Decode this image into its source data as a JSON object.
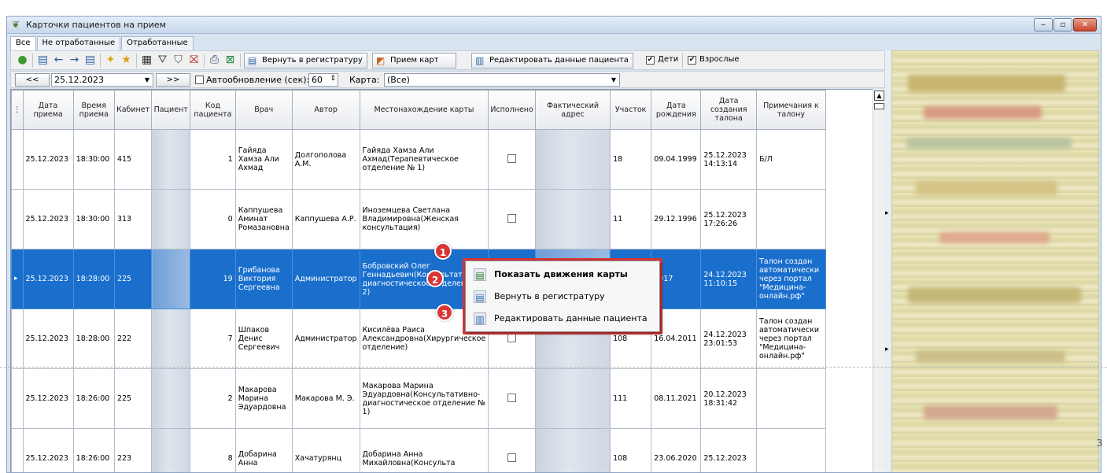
{
  "window": {
    "title": "Карточки пациентов на прием",
    "controls": {
      "minimize": "‒",
      "restore": "▫",
      "close": "✕"
    }
  },
  "tabs": [
    {
      "label": "Все",
      "active": true
    },
    {
      "label": "Не отработанные",
      "active": false
    },
    {
      "label": "Отработанные",
      "active": false
    }
  ],
  "toolbar": {
    "return_to_registry": "Вернуть в регистратуру",
    "receive_cards": "Прием карт",
    "edit_patient": "Редактировать данные пациента",
    "children_label": "Дети",
    "children_checked": true,
    "adults_label": "Взрослые",
    "adults_checked": true
  },
  "filter": {
    "prev": "<<",
    "date": "25.12.2023",
    "next": ">>",
    "autorefresh_label": "Автообновление (сек):",
    "autorefresh_value": "60",
    "card_label": "Карта:",
    "card_value": "(Все)"
  },
  "grid": {
    "columns": [
      "Дата приема",
      "Время приема",
      "Кабинет",
      "Пациент",
      "Код пациента",
      "Врач",
      "Автор",
      "Местонахождение карты",
      "Исполнено",
      "Фактический адрес",
      "Участок",
      "Дата рождения",
      "Дата создания талона",
      "Примечания к талону"
    ],
    "rows": [
      {
        "date": "25.12.2023",
        "time": "18:30:00",
        "cabinet": "415",
        "code_tail": "1",
        "doctor": "Гайяда Хамза Али Ахмад",
        "author": "Долгополова А.М.",
        "location": "Гайяда Хамза Али Ахмад(Терапевтическое отделение № 1)",
        "district": "18",
        "birth": "09.04.1999",
        "created": "25.12.2023 14:13:14",
        "note": "Б/Л"
      },
      {
        "date": "25.12.2023",
        "time": "18:30:00",
        "cabinet": "313",
        "code_tail": "0",
        "doctor": "Каппушева Аминат Ромазановна",
        "author": "Каппушева А.Р.",
        "location": "Иноземцева Светлана Владимировна(Женская консультация)",
        "district": "11",
        "birth": "29.12.1996",
        "created": "25.12.2023 17:26:26",
        "note": ""
      },
      {
        "date": "25.12.2023",
        "time": "18:28:00",
        "cabinet": "225",
        "code_tail": "19",
        "doctor": "Грибанова Виктория Сергеевна",
        "author": "Администратор",
        "location": "Бобровский Олег Геннадьевич(Консультативно-диагностическое отделение № 2)",
        "district": "",
        "birth": "2017",
        "created": "24.12.2023 11:10:15",
        "note": "Талон создан автоматически через портал \"Медицина-онлайн.рф\""
      },
      {
        "date": "25.12.2023",
        "time": "18:28:00",
        "cabinet": "222",
        "code_tail": "7",
        "doctor": "Шпаков Денис Сергеевич",
        "author": "Администратор",
        "location": "Кисилёва Раиса Александровна(Хирургическое отделение)",
        "district": "108",
        "birth": "16.04.2011",
        "created": "24.12.2023 23:01:53",
        "note": "Талон создан автоматически через портал \"Медицина-онлайн.рф\""
      },
      {
        "date": "25.12.2023",
        "time": "18:26:00",
        "cabinet": "225",
        "code_tail": "2",
        "doctor": "Макарова Марина Эдуардовна",
        "author": "Макарова М. Э.",
        "location": "Макарова Марина Эдуардовна(Консультативно-диагностическое отделение № 1)",
        "district": "111",
        "birth": "08.11.2021",
        "created": "20.12.2023 18:31:42",
        "note": ""
      },
      {
        "date": "25.12.2023",
        "time": "18:26:00",
        "cabinet": "223",
        "code_tail": "8",
        "doctor": "Добарина Анна",
        "author": "Хачатурянц",
        "location": "Добарина Анна Михайловна(Консульта",
        "district": "108",
        "birth": "23.06.2020",
        "created": "25.12.2023",
        "note": ""
      }
    ]
  },
  "context_menu": {
    "items": [
      {
        "label": "Показать движения карты",
        "callout": "1"
      },
      {
        "label": "Вернуть в регистратуру",
        "callout": "2"
      },
      {
        "label": "Редактировать данные пациента",
        "callout": "3"
      }
    ]
  },
  "page_number": "3",
  "accent_color": "#d93535",
  "selection_color": "#1a6fcd"
}
